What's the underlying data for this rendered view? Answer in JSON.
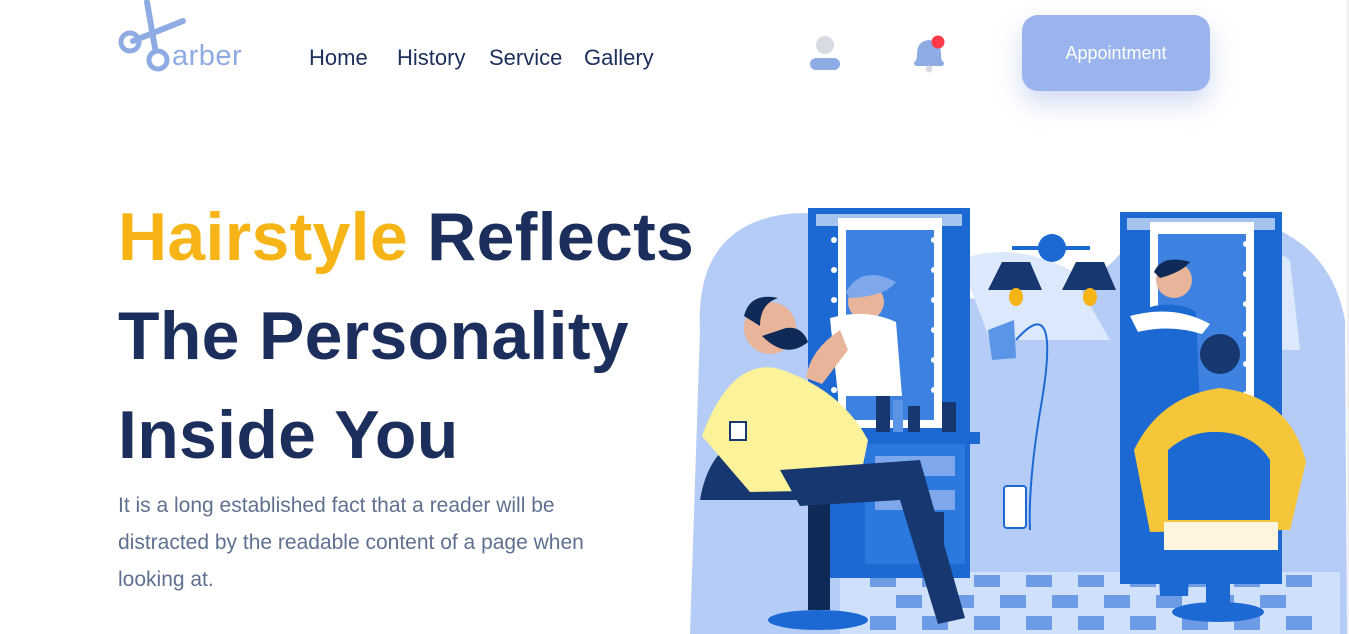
{
  "header": {
    "logo_text": "arber",
    "nav": [
      {
        "label": "Home"
      },
      {
        "label": "History"
      },
      {
        "label": "Service"
      },
      {
        "label": "Gallery"
      }
    ],
    "cta_label": "Appointment",
    "icons": [
      "scissors-icon",
      "user-icon",
      "notification-bell-icon"
    ]
  },
  "hero": {
    "headline_accent": "Hairstyle",
    "headline_line1_rest": " Reflects",
    "headline_line2": "The Personality",
    "headline_line3": "Inside You",
    "description": "It is a long established fact that a reader will be distracted by the readable content of a page when looking at."
  },
  "colors": {
    "brand": "#8eabe4",
    "accent": "#f7b416",
    "heading": "#1c2f5c",
    "button": "#9ab5ee",
    "notification": "#ff3b4a"
  }
}
